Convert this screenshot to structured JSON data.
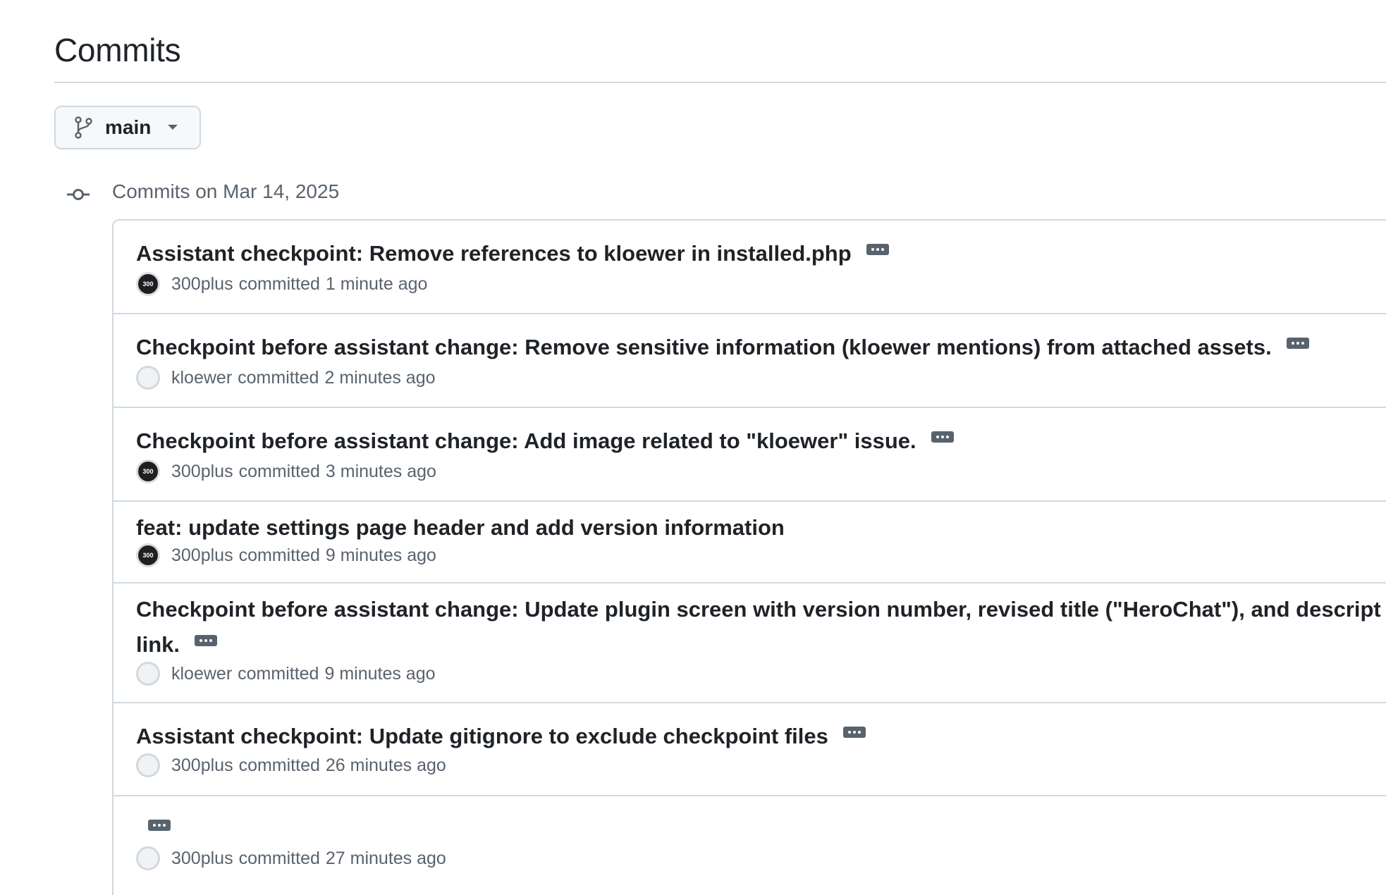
{
  "page": {
    "title": "Commits"
  },
  "branch": {
    "name": "main",
    "icon": "git-branch-icon"
  },
  "group": {
    "heading": "Commits on Mar 14, 2025"
  },
  "commits": [
    {
      "message": "Assistant checkpoint: Remove references to kloewer in installed.php",
      "author": "300plus",
      "verb": "committed",
      "time": "1 minute ago",
      "avatar": "300plus-avatar",
      "has_more": true
    },
    {
      "message": "Checkpoint before assistant change: Remove sensitive information (kloewer mentions) from attached assets.",
      "author": "kloewer",
      "verb": "committed",
      "time": "2 minutes ago",
      "avatar": "default-avatar",
      "has_more": true
    },
    {
      "message": "Checkpoint before assistant change: Add image related to \"kloewer\" issue.",
      "author": "300plus",
      "verb": "committed",
      "time": "3 minutes ago",
      "avatar": "300plus-avatar",
      "has_more": true
    },
    {
      "message": "feat: update settings page header and add version information",
      "author": "300plus",
      "verb": "committed",
      "time": "9 minutes ago",
      "avatar": "300plus-avatar",
      "has_more": false
    },
    {
      "message": "Checkpoint before assistant change: Update plugin screen with version number, revised title (\"HeroChat\"), and descript",
      "message_line2": "link.",
      "author": "kloewer",
      "verb": "committed",
      "time": "9 minutes ago",
      "avatar": "default-avatar",
      "has_more": true
    },
    {
      "message": "Assistant checkpoint: Update gitignore to exclude checkpoint files",
      "author": "300plus",
      "verb": "committed",
      "time": "26 minutes ago",
      "avatar": "default-avatar",
      "has_more": true
    },
    {
      "message": "",
      "author": "300plus",
      "verb": "committed",
      "time": "27 minutes ago",
      "avatar": "default-avatar",
      "has_more": true
    }
  ],
  "avatar_text": {
    "300plus": "300"
  }
}
